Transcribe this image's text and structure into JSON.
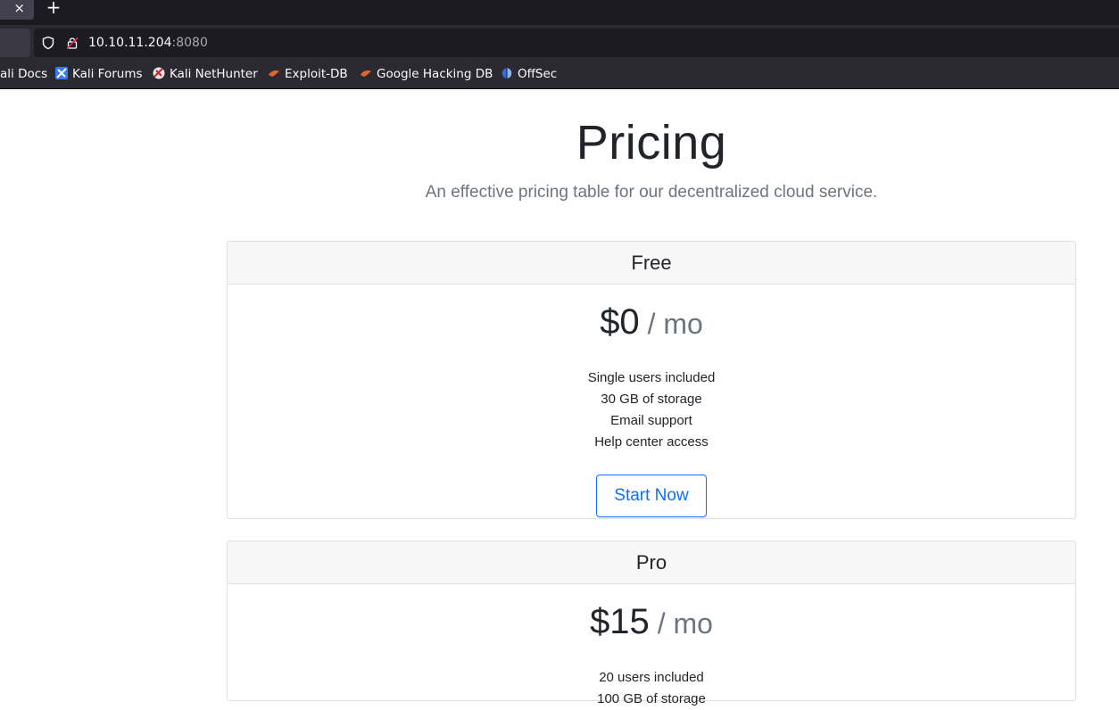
{
  "browser": {
    "tab_close_glyph": "×",
    "new_tab_glyph": "+",
    "url_host": "10.10.11.204",
    "url_port": ":8080",
    "bookmarks": [
      {
        "label": "ali Docs",
        "icon": "kali-docs-icon"
      },
      {
        "label": "Kali Forums",
        "icon": "kali-forums-icon"
      },
      {
        "label": "Kali NetHunter",
        "icon": "kali-nethunter-icon"
      },
      {
        "label": "Exploit-DB",
        "icon": "exploit-db-icon"
      },
      {
        "label": "Google Hacking DB",
        "icon": "ghdb-icon"
      },
      {
        "label": "OffSec",
        "icon": "offsec-icon"
      }
    ]
  },
  "page": {
    "title": "Pricing",
    "subtitle": "An effective pricing table for our decentralized cloud service."
  },
  "plans": [
    {
      "name": "Free",
      "price": "$0",
      "period": " / mo",
      "features": [
        "Single users included",
        "30 GB of storage",
        "Email support",
        "Help center access"
      ],
      "button": "Start Now"
    },
    {
      "name": "Pro",
      "price": "$15",
      "period": " / mo",
      "features": [
        "20 users included",
        "100 GB of storage"
      ]
    }
  ],
  "colors": {
    "primary": "#0d6efd",
    "muted": "#6c757d",
    "chrome_dark": "#1c1b22",
    "chrome": "#2b2a33"
  }
}
